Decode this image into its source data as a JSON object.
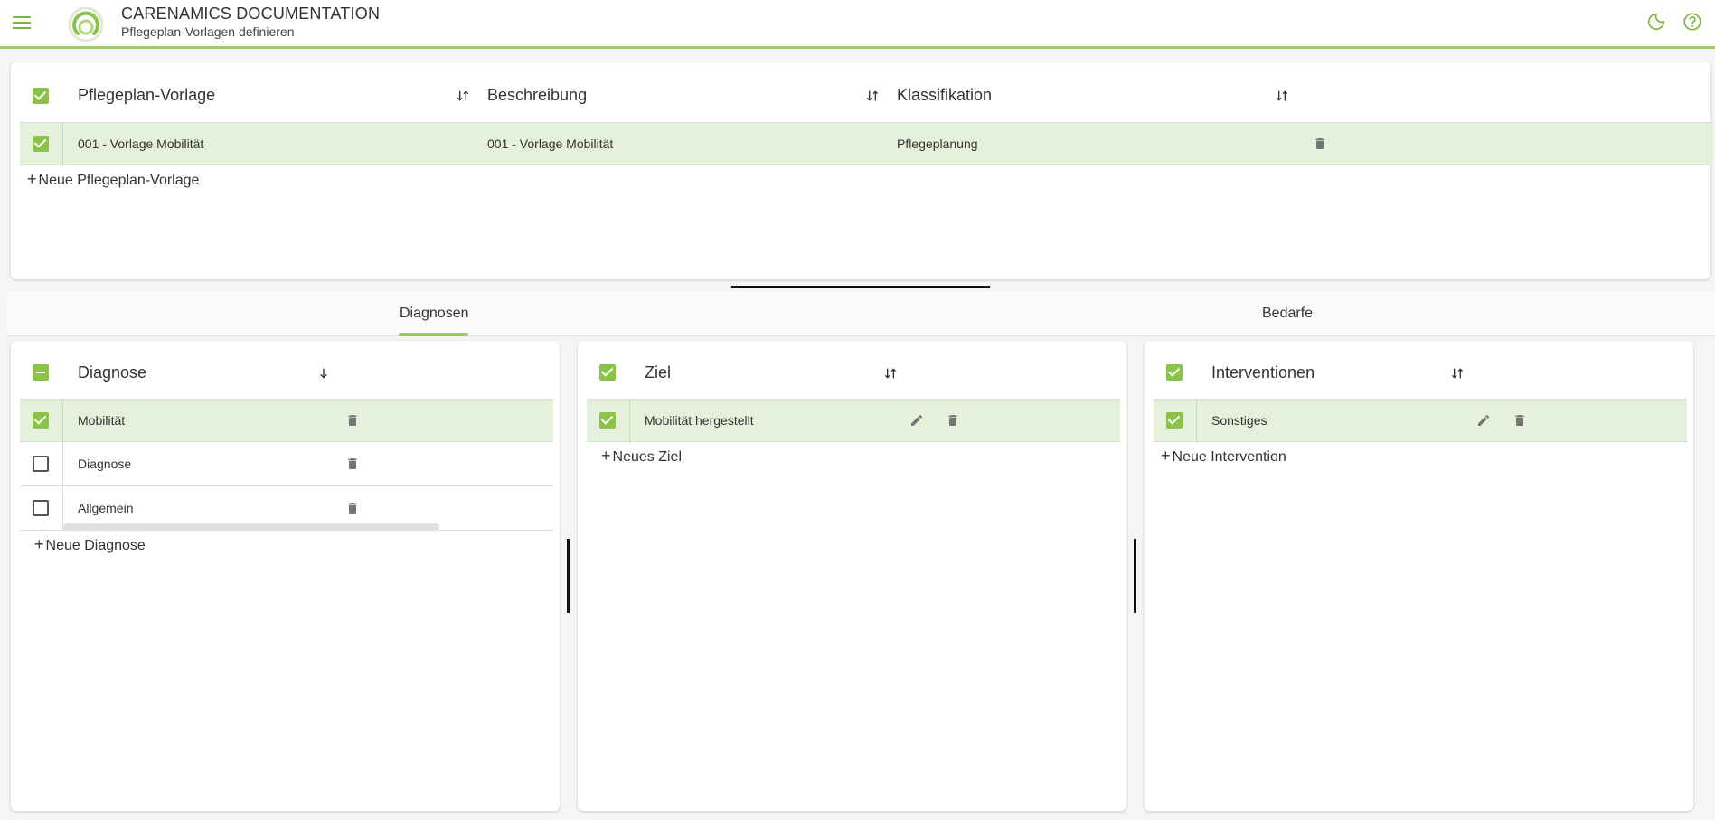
{
  "app": {
    "title": "CARENAMICS DOCUMENTATION",
    "subtitle": "Pflegeplan-Vorlagen definieren",
    "accent_color": "#8bc34a"
  },
  "header_icons": [
    "menu-icon",
    "moon-icon",
    "help-icon"
  ],
  "templates": {
    "columns": [
      "Pflegeplan-Vorlage",
      "Beschreibung",
      "Klassifikation"
    ],
    "rows": [
      {
        "name": "001 - Vorlage Mobilität",
        "description": "001 - Vorlage Mobilität",
        "classification": "Pflegeplanung",
        "selected": true
      }
    ],
    "add_label": "Neue Pflegeplan-Vorlage"
  },
  "tabs": [
    {
      "label": "Diagnosen",
      "active": true
    },
    {
      "label": "Bedarfe",
      "active": false
    }
  ],
  "diagnoses": {
    "header": "Diagnose",
    "rows": [
      {
        "label": "Mobilität",
        "checked": true
      },
      {
        "label": "Diagnose",
        "checked": false
      },
      {
        "label": "Allgemein",
        "checked": false
      }
    ],
    "add_label": "Neue Diagnose"
  },
  "goals": {
    "header": "Ziel",
    "rows": [
      {
        "label": "Mobilität hergestellt",
        "checked": true
      }
    ],
    "add_label": "Neues Ziel"
  },
  "interventions": {
    "header": "Interventionen",
    "rows": [
      {
        "label": "Sonstiges",
        "checked": true
      }
    ],
    "add_label": "Neue Intervention"
  }
}
